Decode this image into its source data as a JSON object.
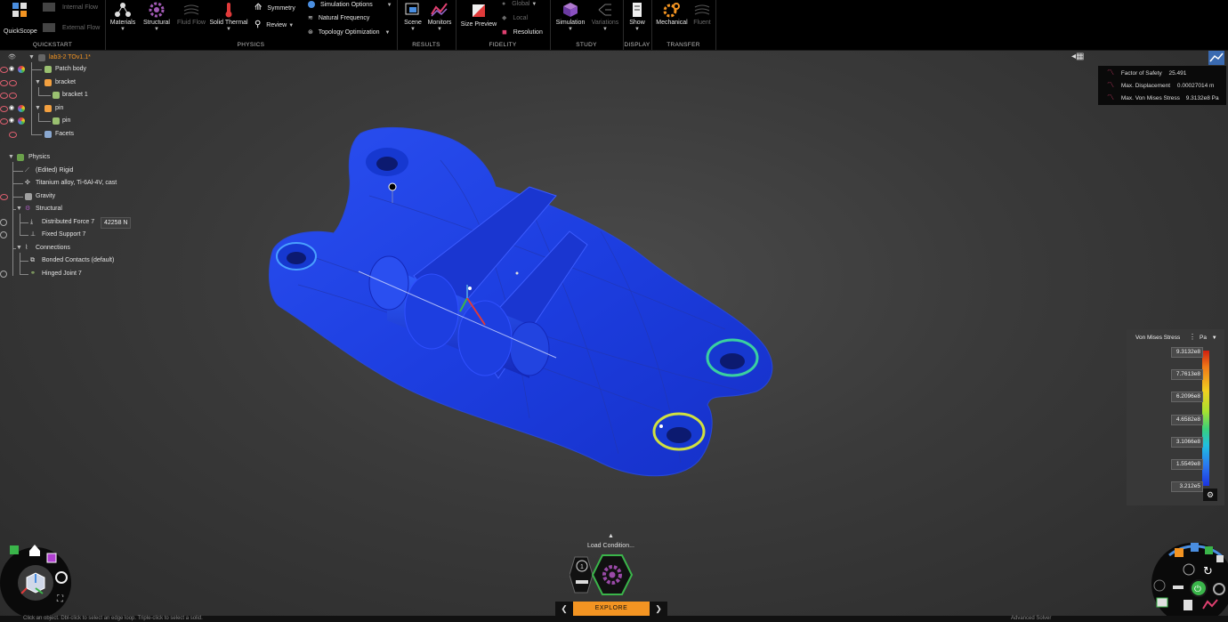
{
  "ribbon": {
    "quickstart": {
      "label": "QUICKSTART",
      "quickscope": "QuickScope",
      "internal_flow": "Internal Flow",
      "external_flow": "External Flow"
    },
    "physics": {
      "label": "PHYSICS",
      "materials": "Materials",
      "structural": "Structural",
      "fluid_flow": "Fluid Flow",
      "solid_thermal": "Solid Thermal",
      "symmetry": "Symmetry",
      "review": "Review",
      "simulation_options": "Simulation Options",
      "natural_frequency": "Natural Frequency",
      "topology_optimization": "Topology Optimization"
    },
    "results": {
      "label": "RESULTS",
      "scene": "Scene",
      "monitors": "Monitors"
    },
    "fidelity": {
      "label": "FIDELITY",
      "size_preview": "Size Preview",
      "global": "Global",
      "local": "Local",
      "resolution": "Resolution"
    },
    "study": {
      "label": "STUDY",
      "simulation": "Simulation",
      "variations": "Variations"
    },
    "display": {
      "label": "DISPLAY",
      "show": "Show"
    },
    "transfer": {
      "label": "TRANSFER",
      "mechanical": "Mechanical",
      "fluent": "Fluent"
    }
  },
  "tree": {
    "root": "lab3-2 TOv1.1*",
    "patch_body": "Patch body",
    "bracket_group": "bracket",
    "bracket1": "bracket 1",
    "pin_group": "pin",
    "pin": "pin",
    "facets": "Facets",
    "physics": "Physics",
    "rigid": "(Edited) Rigid",
    "material": "Titanium alloy, Ti-6Al-4V, cast",
    "gravity": "Gravity",
    "structural": "Structural",
    "force": "Distributed Force 7",
    "force_value": "42258 N",
    "support": "Fixed Support 7",
    "connections": "Connections",
    "bonded": "Bonded Contacts (default)",
    "hinged": "Hinged Joint 7"
  },
  "results": {
    "fos_label": "Factor of Safety",
    "fos_value": "25.491",
    "disp_label": "Max. Displacement",
    "disp_value": "0.00027014 m",
    "stress_label": "Max. Von Mises Stress",
    "stress_value": "9.3132e8 Pa"
  },
  "legend": {
    "title": "Von Mises Stress",
    "unit": "Pa",
    "ticks": [
      "9.3132e8",
      "7.7613e8",
      "6.2096e8",
      "4.6582e8",
      "3.1066e8",
      "1.5549e8",
      "3.212e5"
    ]
  },
  "bottom": {
    "load_condition": "Load Condition...",
    "explore": "EXPLORE",
    "status_text": "Click an object. Dbl-click to select an edge loop. Triple-click to select a solid.",
    "advanced_solver": "Advanced Solver"
  },
  "colors": {
    "accent_orange": "#f39422",
    "stress_blue": "#1d42e8",
    "gear_purple": "#9a4aa8",
    "hex_green": "#3ab54a"
  }
}
